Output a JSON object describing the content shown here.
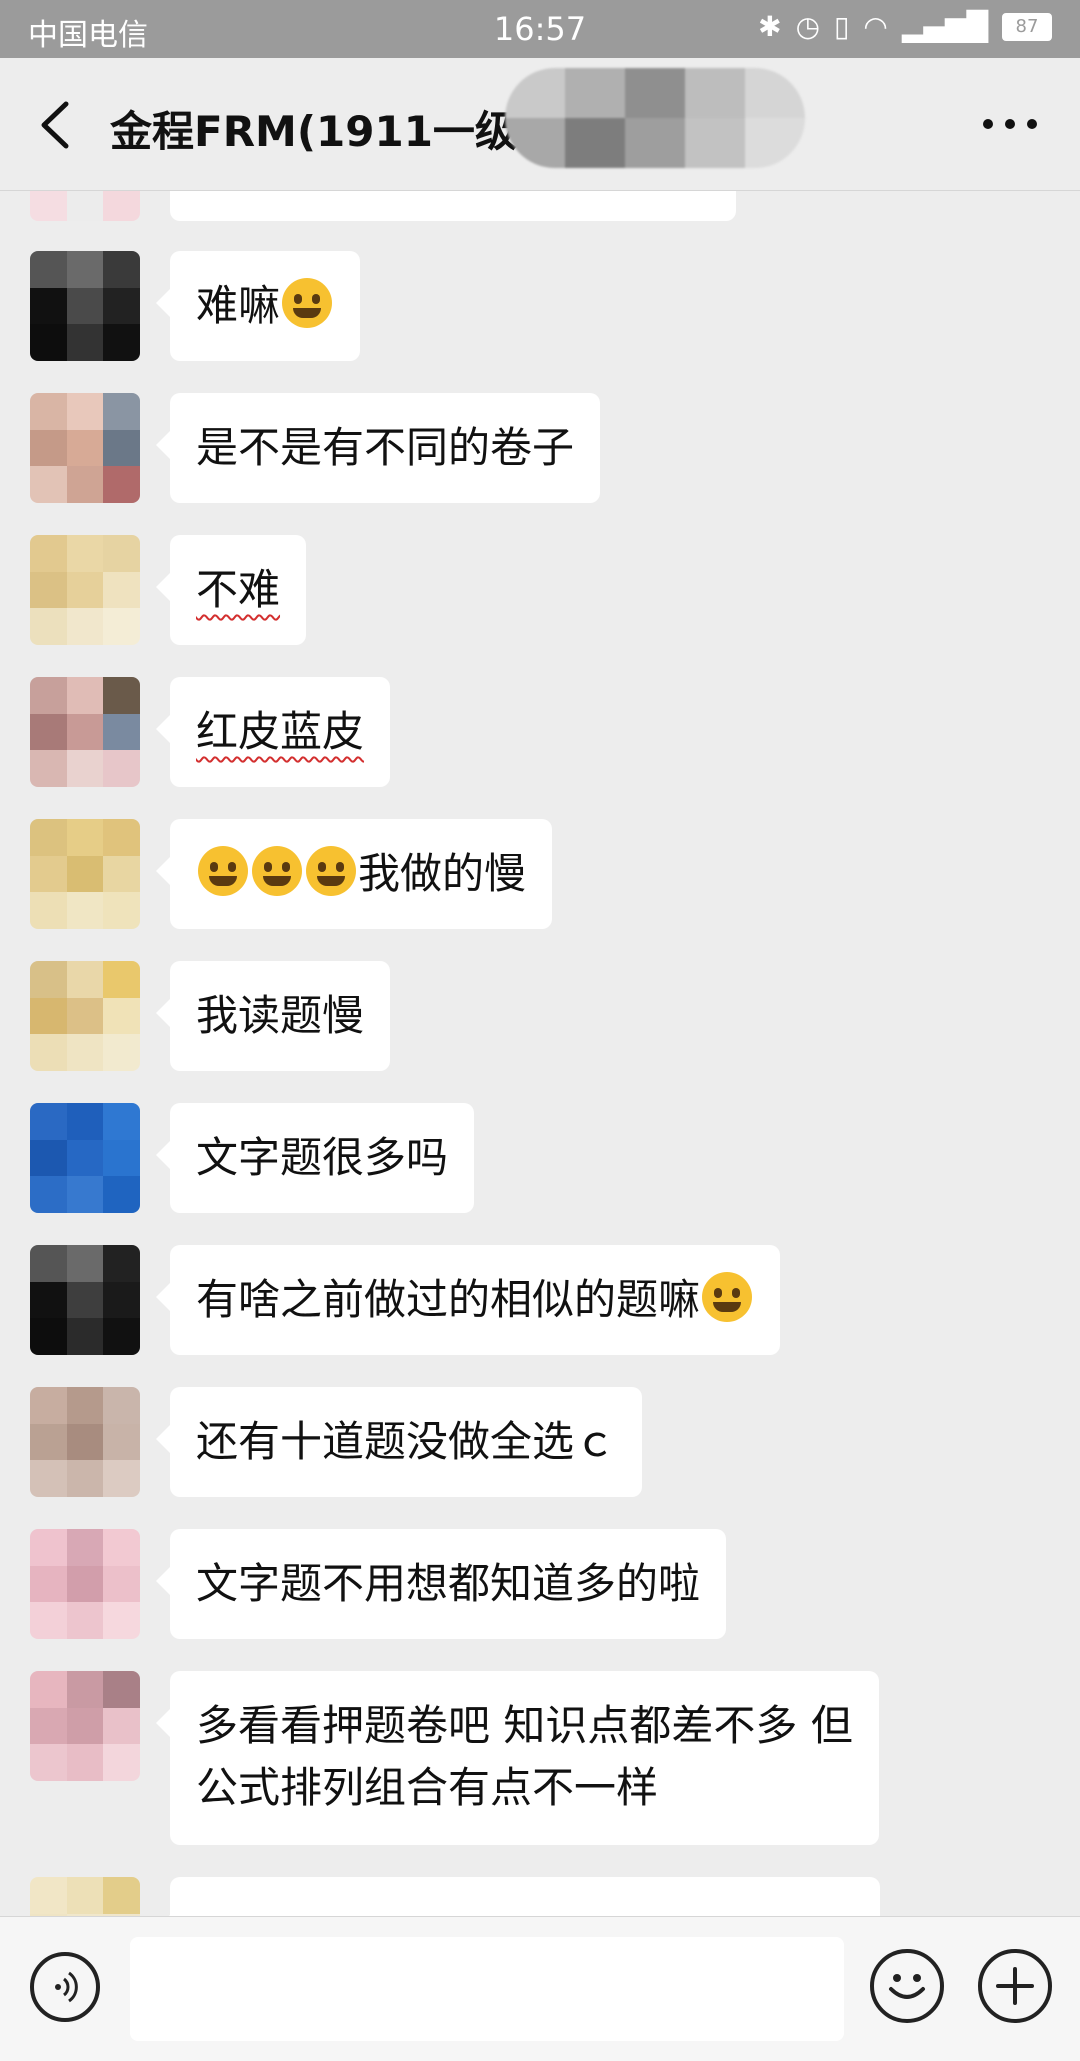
{
  "status_bar": {
    "carrier": "中国电信",
    "time": "16:57",
    "battery": "87"
  },
  "header": {
    "title": "金程FRM(1911一级)"
  },
  "messages": [
    {
      "text": "",
      "emoji": ""
    },
    {
      "text": "难嘛",
      "emoji": "grinning-emoji"
    },
    {
      "text": "是不是有不同的卷子"
    },
    {
      "text": "不难"
    },
    {
      "text": "红皮蓝皮"
    },
    {
      "text": "我做的慢",
      "emoji": "facepalm-emoji"
    },
    {
      "text": "我读题慢"
    },
    {
      "text": "文字题很多吗"
    },
    {
      "text": "有啥之前做过的相似的题嘛",
      "emoji": "thinking-emoji"
    },
    {
      "text": "还有十道题没做全选ｃ"
    },
    {
      "text": "文字题不用想都知道多的啦"
    },
    {
      "text_line1": "多看看押题卷吧 知识点都差不多 但",
      "text_line2": "公式排列组合有点不一样"
    },
    {
      "text": ""
    }
  ],
  "colors": {
    "background": "#ededed",
    "bubble": "#ffffff",
    "status_bar": "#9b9b9b",
    "underline": "#d32f2f"
  }
}
